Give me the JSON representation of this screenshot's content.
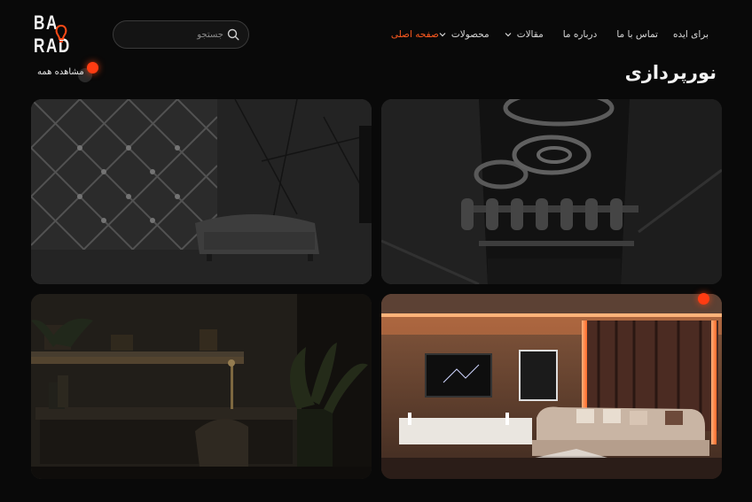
{
  "header": {
    "logo_text": "BA  RAD",
    "search": {
      "placeholder": "جستجو"
    },
    "nav": [
      {
        "label": "صفحه اصلی",
        "active": true,
        "has_dropdown": false
      },
      {
        "label": "محصولات",
        "active": false,
        "has_dropdown": true
      },
      {
        "label": "مقالات",
        "active": false,
        "has_dropdown": true
      },
      {
        "label": "درباره ما",
        "active": false,
        "has_dropdown": false
      },
      {
        "label": "تماس با ما",
        "active": false,
        "has_dropdown": false
      },
      {
        "label": "برای ایده",
        "active": false,
        "has_dropdown": false
      }
    ]
  },
  "section": {
    "title": "نورپردازی",
    "view_all_label": "مشاهده همه"
  },
  "gallery": {
    "items": [
      {
        "subject": "stairwell with ring lights",
        "highlighted": false
      },
      {
        "subject": "quilted wall with sofa",
        "highlighted": false
      },
      {
        "subject": "living room with orange led strips",
        "highlighted": true
      },
      {
        "subject": "desk with under-shelf lighting",
        "highlighted": false
      }
    ]
  },
  "colors": {
    "accent": "#ff5a1f",
    "background": "#090909",
    "dot": "#ff3c12"
  }
}
